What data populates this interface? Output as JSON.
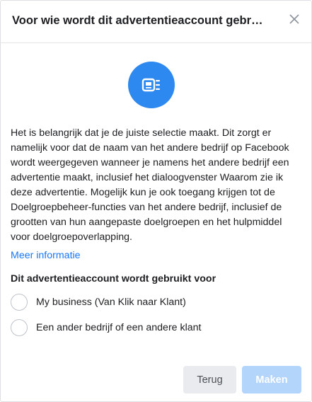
{
  "dialog": {
    "title": "Voor wie wordt dit advertentieaccount gebr…",
    "close_icon": "close-icon",
    "hero_icon": "ad-preview-icon",
    "colors": {
      "accent": "#2d88f0",
      "link": "#1877f2",
      "disabled_primary": "#b3d4fb"
    },
    "description": "Het is belangrijk dat je de juiste selectie maakt. Dit zorgt er namelijk voor dat de naam van het andere bedrijf op Facebook wordt weergegeven wanneer je namens het andere bedrijf een advertentie maakt, inclusief het dialoogvenster Waarom zie ik deze advertentie. Mogelijk kun je ook toegang krijgen tot de Doelgroepbeheer-functies van het andere bedrijf, inclusief de grootten van hun aangepaste doelgroepen en het hulpmiddel voor doelgroepoverlapping.",
    "more_link": "Meer informatie",
    "section_label": "Dit advertentieaccount wordt gebruikt voor",
    "options": [
      {
        "label": "My business (Van Klik naar Klant)"
      },
      {
        "label": "Een ander bedrijf of een andere klant"
      }
    ],
    "buttons": {
      "back": "Terug",
      "create": "Maken"
    }
  }
}
